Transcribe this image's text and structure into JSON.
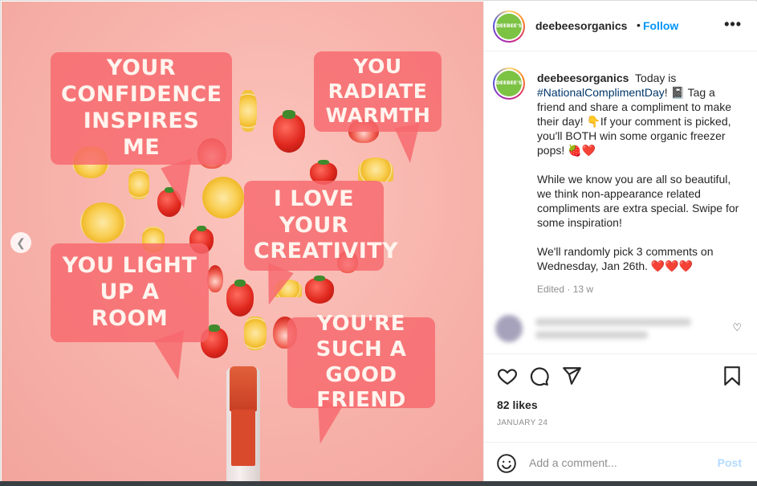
{
  "post_image": {
    "bubbles": [
      "YOUR CONFIDENCE INSPIRES ME",
      "YOU RADIATE WARMTH",
      "I LOVE YOUR CREATIVITY",
      "YOU LIGHT UP A ROOM",
      "YOU'RE SUCH A GOOD FRIEND"
    ],
    "nav_prev_icon": "chevron-left-icon"
  },
  "header": {
    "avatar_text": "DEEBEE'S",
    "username": "deebeesorganics",
    "separator": "•",
    "follow_label": "Follow",
    "more_icon": "ellipsis-icon"
  },
  "caption": {
    "username": "deebeesorganics",
    "text_before_tag": "Today is",
    "hashtag": "#NationalComplimentDay",
    "text_after_tag": "! 📓 Tag a friend and share a compliment to make their day! 👇If your comment is picked, you'll BOTH win some organic freezer pops! 🍓❤️",
    "paragraph2": "While we know you are all so beautiful, we think non-appearance related compliments are extra special. Swipe for some inspiration!",
    "paragraph3": "We'll randomly pick 3 comments on Wednesday, Jan 26th. ❤️❤️❤️",
    "meta": "Edited · 13 w"
  },
  "actions": {
    "like_icon": "heart-icon",
    "comment_icon": "comment-icon",
    "share_icon": "send-icon",
    "save_icon": "bookmark-icon"
  },
  "likes_text": "82 likes",
  "date_text": "JANUARY 24",
  "add_comment": {
    "placeholder": "Add a comment...",
    "post_label": "Post",
    "emoji_icon": "smiley-icon"
  },
  "colors": {
    "follow": "#0095f6",
    "bubble": "#f6686c",
    "post_disabled": "#b3dbff",
    "hashtag": "#00376b"
  }
}
